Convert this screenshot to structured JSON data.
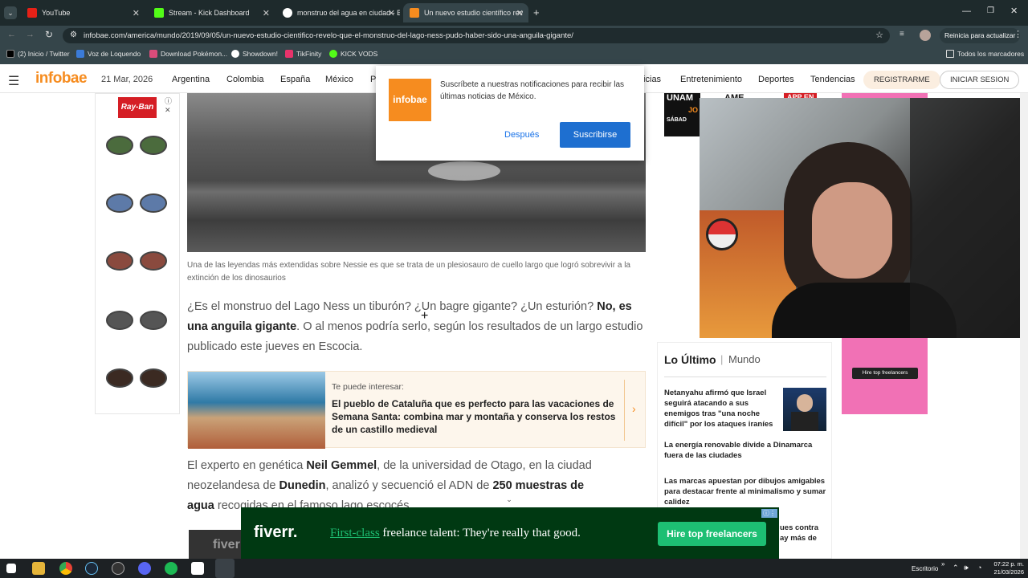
{
  "browser": {
    "tabs": [
      {
        "label": "YouTube"
      },
      {
        "label": "Stream - Kick Dashboard"
      },
      {
        "label": "monstruo del agua en ciudad - B"
      },
      {
        "label": "Un nuevo estudio científico rev"
      }
    ],
    "url": "infobae.com/america/mundo/2019/09/05/un-nuevo-estudio-cientifico-revelo-que-el-monstruo-del-lago-ness-pudo-haber-sido-una-anguila-gigante/",
    "update_label": "Reinicia para actualizar",
    "bookmarks": [
      "(2) Inicio / Twitter",
      "Voz de Loquendo",
      "Download Pokémon...",
      "Showdown!",
      "TikFinity",
      "KICK VODS"
    ],
    "all_bookmarks": "Todos los marcadores"
  },
  "site": {
    "logo": "infobae",
    "date": "21 Mar, 2026",
    "nav": [
      "Argentina",
      "Colombia",
      "España",
      "México",
      "P",
      "ticias",
      "Entretenimiento",
      "Deportes",
      "Tendencias"
    ],
    "register": "REGISTRARME",
    "login": "INICIAR SESION"
  },
  "notification": {
    "logo": "infobae",
    "text": "Suscríbete a nuestras notificaciones para recibir las últimas noticias de México.",
    "later": "Después",
    "subscribe": "Suscribirse"
  },
  "article": {
    "caption": "Una de las leyendas más extendidas sobre Nessie es que se trata de un plesiosauro de cuello largo que logró sobrevivir a la extinción de los dinosaurios",
    "p1_a": "¿Es el monstruo del Lago Ness un tiburón? ¿Un bagre gigante? ¿Un esturión? ",
    "p1_b": "No, es una anguila gigante",
    "p1_c": ". O al menos podría serlo, según los resultados de un largo estudio publicado este jueves en Escocia.",
    "related_kicker": "Te puede interesar:",
    "related_title": "El pueblo de Cataluña que es perfecto para las vacaciones de Semana Santa: combina mar y montaña y conserva los restos de un castillo medieval",
    "p2_a": "El experto en genética ",
    "p2_b": "Neil Gemmel",
    "p2_c": ", de la universidad de Otago, en la ciudad neozelandesa de ",
    "p2_d": "Dunedin",
    "p2_e": ", analizó y secuenció el ADN de ",
    "p2_f": "250 muestras de agua",
    "p2_g": " recogidas en el famoso lago escocés"
  },
  "sidebar": {
    "ad_brand": "Ray-Ban",
    "latest_title": "Lo Último",
    "latest_section": "Mundo",
    "news": [
      "Netanyahu afirmó que Israel seguirá atacando a sus enemigos tras \"una noche difícil\" por los ataques iraníes",
      "La energía renovable divide a Dinamarca fuera de las ciudades",
      "Las marcas apuestan por dibujos amigables para destacar frente al minimalismo y sumar calidez",
      "ues contra",
      "ay más de"
    ],
    "top_ad_a": "UNAM",
    "top_ad_b": "AME",
    "top_ad_c": "APP EN",
    "top_ad_d": "SÁBAD",
    "top_ad_e": "JO",
    "pink_ad": "Hire top freelancers"
  },
  "bottom_ad": {
    "brand": "fiverr.",
    "text_a": "First-class",
    "text_b": " freelance talent: They're really that good.",
    "cta": "Hire top freelancers",
    "partial": "fiver"
  },
  "taskbar": {
    "desk": "Escritorio",
    "time": "07:22 p. m.",
    "date": "21/03/2026"
  }
}
